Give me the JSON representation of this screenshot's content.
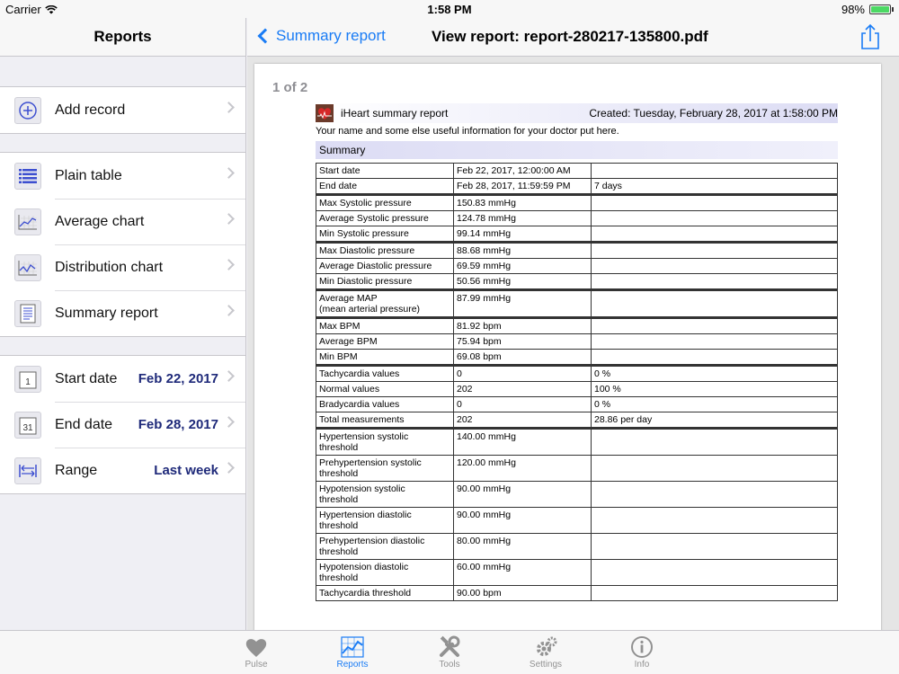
{
  "status": {
    "carrier": "Carrier",
    "time": "1:58 PM",
    "battery": "98%",
    "battery_level": 0.98
  },
  "left": {
    "title": "Reports",
    "groups": [
      {
        "items": [
          {
            "label": "Add record",
            "icon": "plus-circle-icon"
          }
        ]
      },
      {
        "items": [
          {
            "label": "Plain table",
            "icon": "table-icon"
          },
          {
            "label": "Average chart",
            "icon": "line-chart-icon"
          },
          {
            "label": "Distribution chart",
            "icon": "distribution-chart-icon"
          },
          {
            "label": "Summary report",
            "icon": "document-icon"
          }
        ]
      },
      {
        "items": [
          {
            "label": "Start date",
            "value": "Feb 22, 2017",
            "icon": "calendar-1-icon",
            "icon_text": "1"
          },
          {
            "label": "End date",
            "value": "Feb 28, 2017",
            "icon": "calendar-31-icon",
            "icon_text": "31"
          },
          {
            "label": "Range",
            "value": "Last week",
            "icon": "range-arrows-icon"
          }
        ]
      }
    ]
  },
  "nav": {
    "back_label": "Summary report",
    "title": "View report: report-280217-135800.pdf",
    "share_icon": "share-icon"
  },
  "doc": {
    "page_count": "1 of 2",
    "report_title": "iHeart summary report",
    "created": "Created: Tuesday, February 28, 2017 at 1:58:00 PM",
    "info": "Your name and some else useful information for your doctor put here.",
    "summary_label": "Summary",
    "rows": [
      {
        "a": "Start date",
        "b": "Feb 22, 2017, 12:00:00 AM",
        "c": "",
        "gap": false
      },
      {
        "a": "End date",
        "b": "Feb 28, 2017, 11:59:59 PM",
        "c": "7 days",
        "gap": false
      },
      {
        "a": "Max Systolic pressure",
        "b": "150.83 mmHg",
        "c": "",
        "gap": true
      },
      {
        "a": "Average Systolic pressure",
        "b": "124.78 mmHg",
        "c": "",
        "gap": false
      },
      {
        "a": "Min Systolic pressure",
        "b": "99.14 mmHg",
        "c": "",
        "gap": false
      },
      {
        "a": "Max Diastolic pressure",
        "b": "88.68 mmHg",
        "c": "",
        "gap": true
      },
      {
        "a": "Average Diastolic pressure",
        "b": "69.59 mmHg",
        "c": "",
        "gap": false
      },
      {
        "a": "Min Diastolic pressure",
        "b": "50.56 mmHg",
        "c": "",
        "gap": false
      },
      {
        "a": "Average MAP\n(mean arterial pressure)",
        "b": "87.99 mmHg",
        "c": "",
        "gap": true
      },
      {
        "a": "Max BPM",
        "b": "81.92 bpm",
        "c": "",
        "gap": true
      },
      {
        "a": "Average BPM",
        "b": "75.94 bpm",
        "c": "",
        "gap": false
      },
      {
        "a": "Min BPM",
        "b": "69.08 bpm",
        "c": "",
        "gap": false
      },
      {
        "a": "Tachycardia values",
        "b": "0",
        "c": "0 %",
        "gap": true
      },
      {
        "a": "Normal values",
        "b": "202",
        "c": "100 %",
        "gap": false
      },
      {
        "a": "Bradycardia values",
        "b": "0",
        "c": "0 %",
        "gap": false
      },
      {
        "a": "Total measurements",
        "b": "202",
        "c": "28.86 per day",
        "gap": false
      },
      {
        "a": "Hypertension systolic\nthreshold",
        "b": "140.00 mmHg",
        "c": "",
        "gap": true
      },
      {
        "a": "Prehypertension systolic\nthreshold",
        "b": "120.00 mmHg",
        "c": "",
        "gap": false
      },
      {
        "a": "Hypotension systolic\nthreshold",
        "b": "90.00 mmHg",
        "c": "",
        "gap": false
      },
      {
        "a": "Hypertension diastolic\nthreshold",
        "b": "90.00 mmHg",
        "c": "",
        "gap": false
      },
      {
        "a": "Prehypertension diastolic\nthreshold",
        "b": "80.00 mmHg",
        "c": "",
        "gap": false
      },
      {
        "a": "Hypotension diastolic\nthreshold",
        "b": "60.00 mmHg",
        "c": "",
        "gap": false
      },
      {
        "a": "Tachycardia threshold",
        "b": "90.00 bpm",
        "c": "",
        "gap": false
      }
    ]
  },
  "tabs": [
    {
      "label": "Pulse",
      "icon": "heart-icon",
      "active": false
    },
    {
      "label": "Reports",
      "icon": "chart-icon",
      "active": true
    },
    {
      "label": "Tools",
      "icon": "tools-icon",
      "active": false
    },
    {
      "label": "Settings",
      "icon": "gear-icon",
      "active": false
    },
    {
      "label": "Info",
      "icon": "info-icon",
      "active": false
    }
  ],
  "colors": {
    "accent": "#1a7cf5",
    "value_text": "#1f2a7a",
    "battery": "#4cd964",
    "heart": "#c0392b"
  }
}
